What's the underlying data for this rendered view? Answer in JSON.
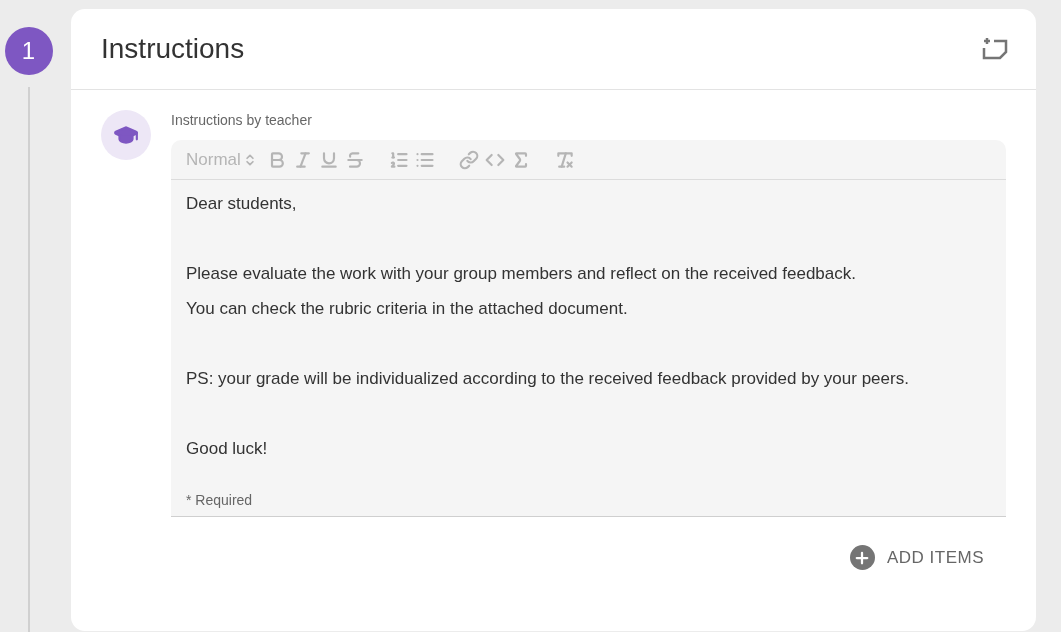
{
  "step": {
    "number": "1"
  },
  "card": {
    "title": "Instructions"
  },
  "instructions": {
    "label": "Instructions by teacher",
    "toolbar": {
      "format": "Normal"
    },
    "blocks": [
      [
        "Dear students,"
      ],
      [
        "Please evaluate the work with your group members and reflect on the received feedback.",
        "You can check the rubric criteria in the attached document."
      ],
      [
        "PS: your grade will be individualized according to the received feedback provided by your peers."
      ],
      [
        "Good luck!"
      ]
    ],
    "required_note": "* Required"
  },
  "add_button": {
    "label": "ADD ITEMS"
  }
}
